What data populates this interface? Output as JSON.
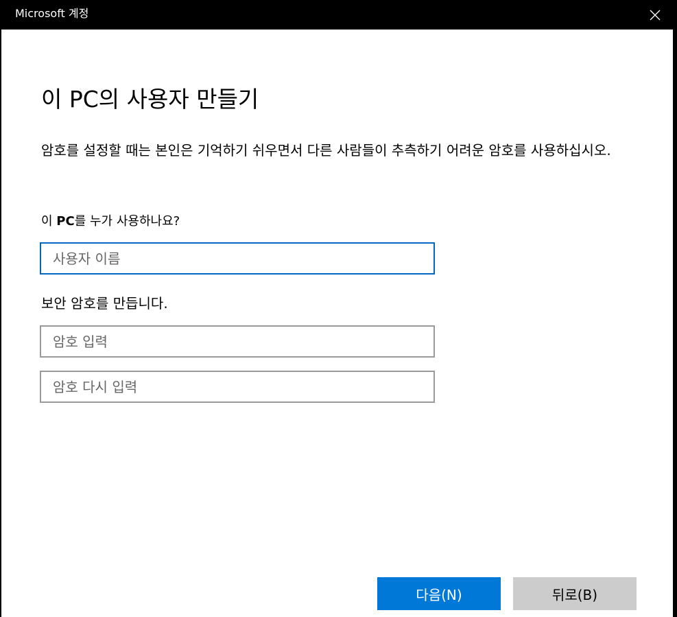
{
  "window": {
    "title": "Microsoft 계정"
  },
  "main": {
    "heading": "이 PC의 사용자 만들기",
    "description": "암호를 설정할 때는 본인은 기억하기 쉬우면서 다른 사람들이 추측하기 어려운 암호를 사용하십시오.",
    "who_label_prefix": "이 ",
    "who_label_pc": "PC",
    "who_label_suffix": "를 누가 사용하나요?",
    "username_placeholder": "사용자 이름",
    "username_value": "",
    "security_label": "보안 암호를 만듭니다.",
    "password_placeholder": "암호 입력",
    "password_value": "",
    "password_confirm_placeholder": "암호 다시 입력",
    "password_confirm_value": ""
  },
  "buttons": {
    "next_label": "다음(N)",
    "back_label": "뒤로(B)"
  },
  "icons": {
    "close": "close-icon"
  },
  "colors": {
    "accent": "#0078d7",
    "focus_border": "#0067c0",
    "input_border": "#999999",
    "secondary_button": "#cccccc",
    "titlebar": "#000000"
  }
}
